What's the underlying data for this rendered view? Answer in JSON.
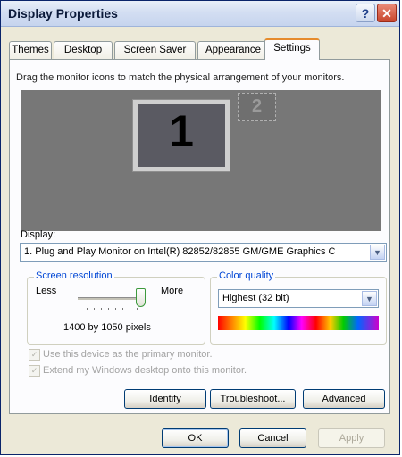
{
  "window": {
    "title": "Display Properties",
    "help_label": "?",
    "close_label": "✕"
  },
  "tabs": [
    {
      "label": "Themes",
      "active": false
    },
    {
      "label": "Desktop",
      "active": false
    },
    {
      "label": "Screen Saver",
      "active": false
    },
    {
      "label": "Appearance",
      "active": false
    },
    {
      "label": "Settings",
      "active": true
    }
  ],
  "settings": {
    "instructions": "Drag the monitor icons to match the physical arrangement of your monitors.",
    "monitors": [
      {
        "number": "1",
        "selected": true
      },
      {
        "number": "2",
        "selected": false
      }
    ],
    "display_label": "Display:",
    "display_value": "1. Plug and Play Monitor on Intel(R) 82852/82855 GM/GME Graphics C",
    "screen_resolution": {
      "legend": "Screen resolution",
      "less_label": "Less",
      "more_label": "More",
      "value_text": "1400 by 1050 pixels",
      "slider_level": 1.0
    },
    "color_quality": {
      "legend": "Color quality",
      "selected": "Highest (32 bit)"
    },
    "checkboxes": [
      {
        "label": "Use this device as the primary monitor.",
        "checked": true,
        "enabled": false
      },
      {
        "label": "Extend my Windows desktop onto this monitor.",
        "checked": true,
        "enabled": false
      }
    ],
    "buttons": {
      "identify": "Identify",
      "troubleshoot": "Troubleshoot...",
      "advanced": "Advanced"
    }
  },
  "footer": {
    "ok": "OK",
    "cancel": "Cancel",
    "apply": "Apply"
  },
  "colors": {
    "title_text": "#0b1a3a",
    "close_button": "#c8452c",
    "preview_background": "#777777",
    "group_legend": "#0046d5",
    "active_tab_accent": "#e68b2c"
  },
  "icons": [
    "help-icon",
    "close-icon",
    "dropdown-arrow-icon",
    "checkmark-icon"
  ]
}
